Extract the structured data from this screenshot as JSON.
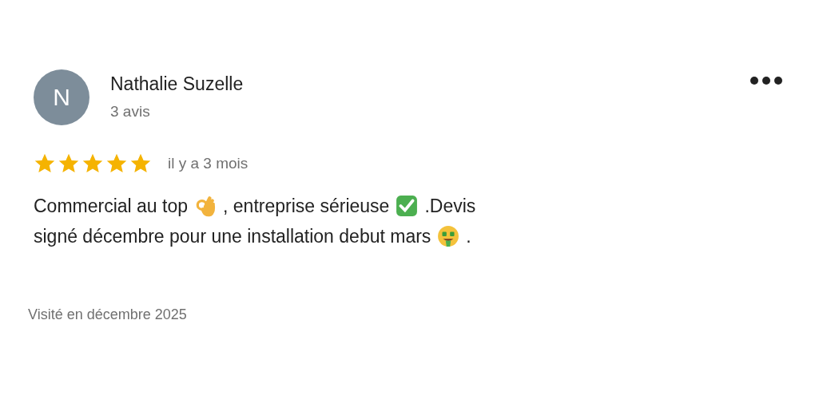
{
  "review": {
    "avatar": "N",
    "author": "Nathalie Suzelle",
    "author_meta": "3 avis",
    "stars": 5,
    "time": "il y a 3 mois",
    "body_lines": [
      [
        {
          "kind": "text",
          "text": "Commercial au top"
        },
        {
          "kind": "ok-hand"
        },
        {
          "kind": "text",
          "text": ", entreprise sérieuse"
        },
        {
          "kind": "check"
        },
        {
          "kind": "text",
          "text": ".Devis"
        }
      ],
      [
        {
          "kind": "text",
          "text": "signé décembre pour une installation debut mars"
        },
        {
          "kind": "money-face"
        },
        {
          "kind": "text",
          "text": "."
        }
      ]
    ],
    "visited": "Visité en décembre 2025"
  }
}
